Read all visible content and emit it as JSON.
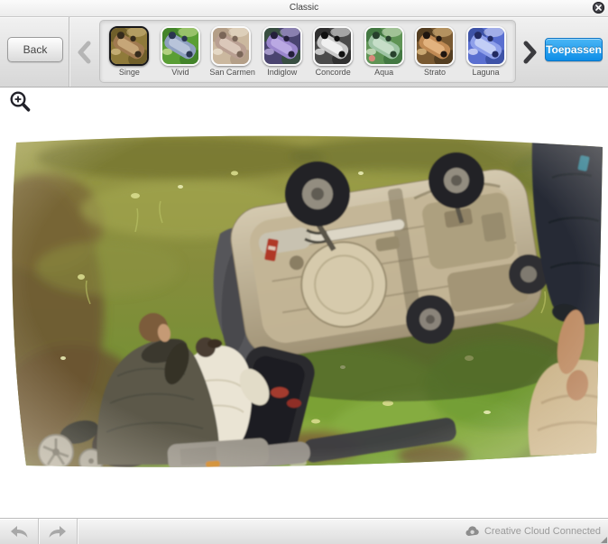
{
  "titlebar": {
    "title": "Classic"
  },
  "toolbar": {
    "back_label": "Back",
    "apply_label": "Toepassen"
  },
  "filters": {
    "selected": "Singe",
    "items": [
      {
        "label": "Singe",
        "selected": true,
        "palette": {
          "bg": "#8f7a3a",
          "veg": "#6b5a28",
          "car": "#a07a50",
          "car2": "#c6a678",
          "dark": "#352b1c",
          "light": "#d8c08a"
        }
      },
      {
        "label": "Vivid",
        "selected": false,
        "palette": {
          "bg": "#5a9e35",
          "veg": "#3f7f28",
          "car": "#8fa0c0",
          "car2": "#b8c4da",
          "dark": "#2a3550",
          "light": "#d6e6a0"
        }
      },
      {
        "label": "San Carmen",
        "selected": false,
        "palette": {
          "bg": "#cbb89f",
          "veg": "#b09a84",
          "car": "#b99f92",
          "car2": "#dbc8ba",
          "dark": "#7a6658",
          "light": "#f0e5d5"
        }
      },
      {
        "label": "Indiglow",
        "selected": false,
        "palette": {
          "bg": "#4a4470",
          "veg": "#355038",
          "car": "#9a86cc",
          "car2": "#baa9e3",
          "dark": "#241f3a",
          "light": "#cabcf0"
        }
      },
      {
        "label": "Concorde",
        "selected": false,
        "palette": {
          "bg": "#4b4b4b",
          "veg": "#2c2c2c",
          "car": "#c9c9c9",
          "car2": "#f0f0f0",
          "dark": "#101010",
          "light": "#ffffff"
        }
      },
      {
        "label": "Aqua",
        "selected": false,
        "palette": {
          "bg": "#5f9455",
          "veg": "#3e7340",
          "car": "#9ec4a4",
          "car2": "#c6dec8",
          "dark": "#27402c",
          "light": "#e3f0d8",
          "accent": "#d8897a"
        }
      },
      {
        "label": "Strato",
        "selected": false,
        "palette": {
          "bg": "#7a5a32",
          "veg": "#4e3a1e",
          "car": "#c08a54",
          "car2": "#e2b27e",
          "dark": "#1f1610",
          "light": "#edc98e"
        }
      },
      {
        "label": "Laguna",
        "selected": false,
        "palette": {
          "bg": "#5a6fd0",
          "veg": "#3a4fa0",
          "car": "#8fa0ea",
          "car2": "#c2cef6",
          "dark": "#222a60",
          "light": "#e9edff"
        }
      }
    ]
  },
  "statusbar": {
    "connection_label": "Creative Cloud Connected"
  },
  "icons": {
    "close": "close-icon",
    "zoom_in": "zoom-in-icon",
    "prev": "chevron-left-icon",
    "next": "chevron-right-icon",
    "undo": "undo-arrow-icon",
    "redo": "redo-arrow-icon",
    "cloud": "creative-cloud-icon"
  },
  "colors": {
    "accent_blue": "#1a9cf0",
    "selected_filter_border": "#1a1a1e"
  }
}
